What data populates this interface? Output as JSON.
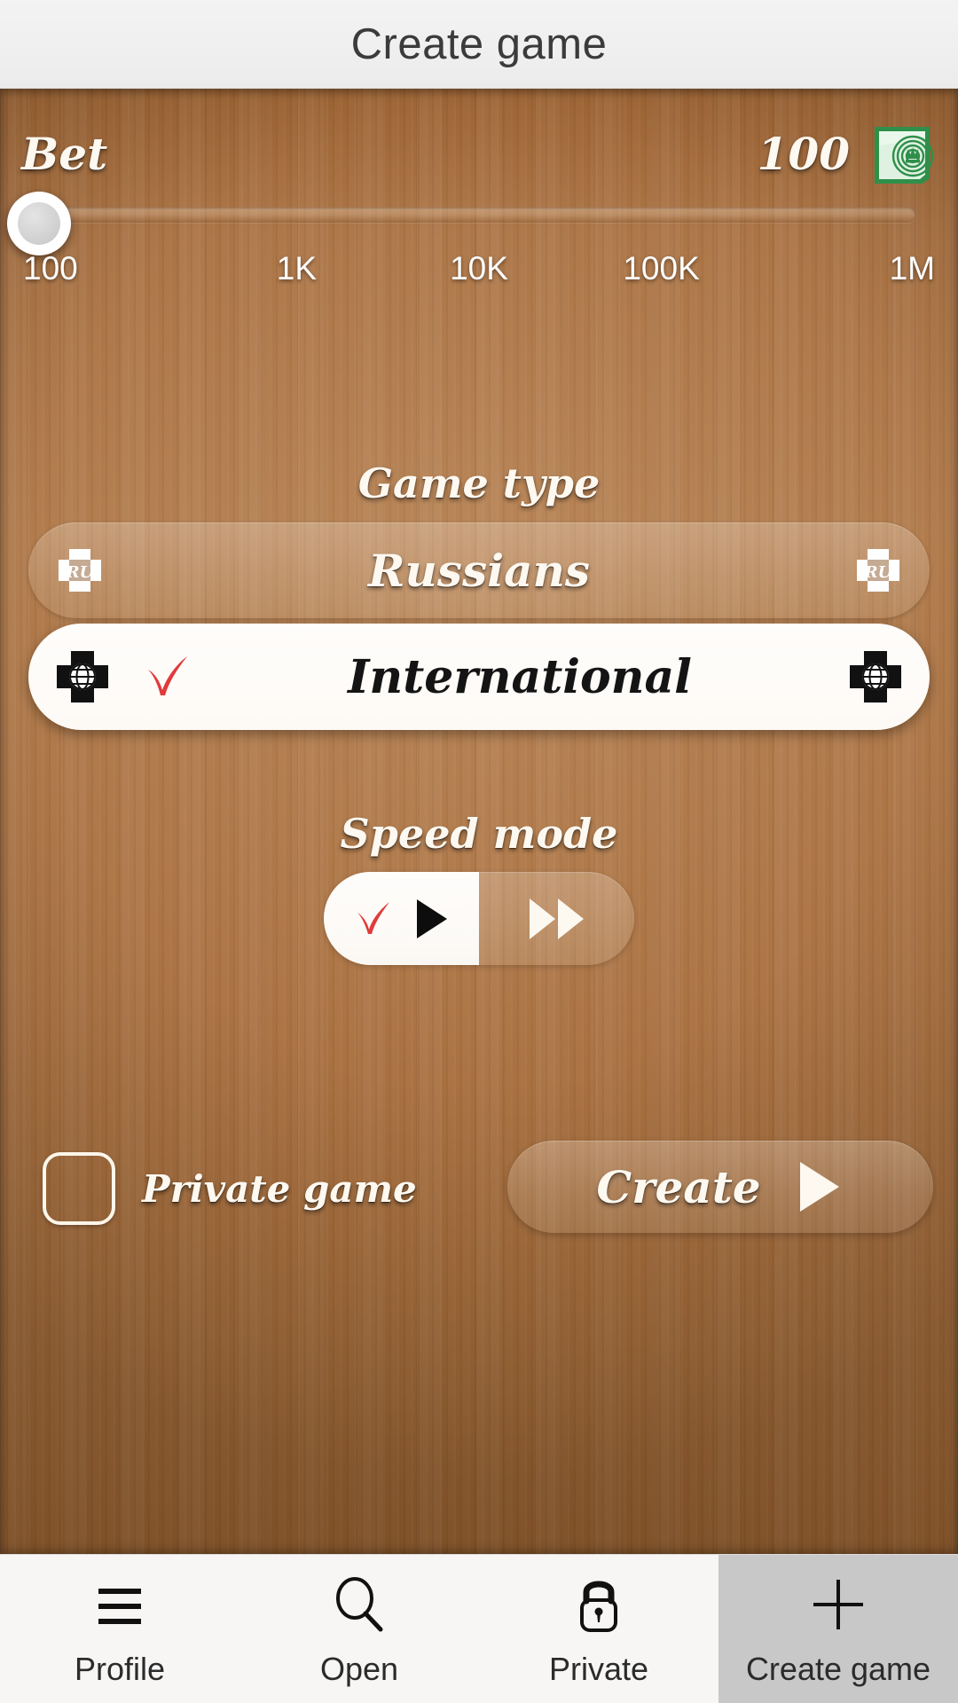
{
  "header": {
    "title": "Create game"
  },
  "bet": {
    "label": "Bet",
    "value": "100",
    "money_icon": "banknote-icon",
    "slider": {
      "thumb_position_percent": 0,
      "ticks": [
        "100",
        "1K",
        "10K",
        "100K",
        "1M"
      ]
    }
  },
  "game_type": {
    "title": "Game type",
    "options": [
      {
        "label": "Russians",
        "icon": "ru-flag-badge-icon",
        "selected": false
      },
      {
        "label": "International",
        "icon": "globe-badge-icon",
        "selected": true
      }
    ]
  },
  "speed_mode": {
    "title": "Speed mode",
    "options": [
      {
        "icon": "play-triangle-icon",
        "selected": true
      },
      {
        "icon": "fast-forward-icon",
        "selected": false
      }
    ]
  },
  "private_game": {
    "label": "Private game",
    "checked": false
  },
  "create_button": {
    "label": "Create",
    "icon": "play-triangle-icon"
  },
  "navbar": {
    "items": [
      {
        "label": "Profile",
        "icon": "hamburger-menu-icon",
        "active": false
      },
      {
        "label": "Open",
        "icon": "search-icon",
        "active": false
      },
      {
        "label": "Private",
        "icon": "lock-icon",
        "active": false
      },
      {
        "label": "Create game",
        "icon": "plus-icon",
        "active": true
      }
    ]
  },
  "colors": {
    "wood": "#ab7445",
    "header_bg": "#f0efef",
    "accent_check": "#e03b3b",
    "money_green": "#3f9e55",
    "nav_active_bg": "#c9c8c8"
  }
}
